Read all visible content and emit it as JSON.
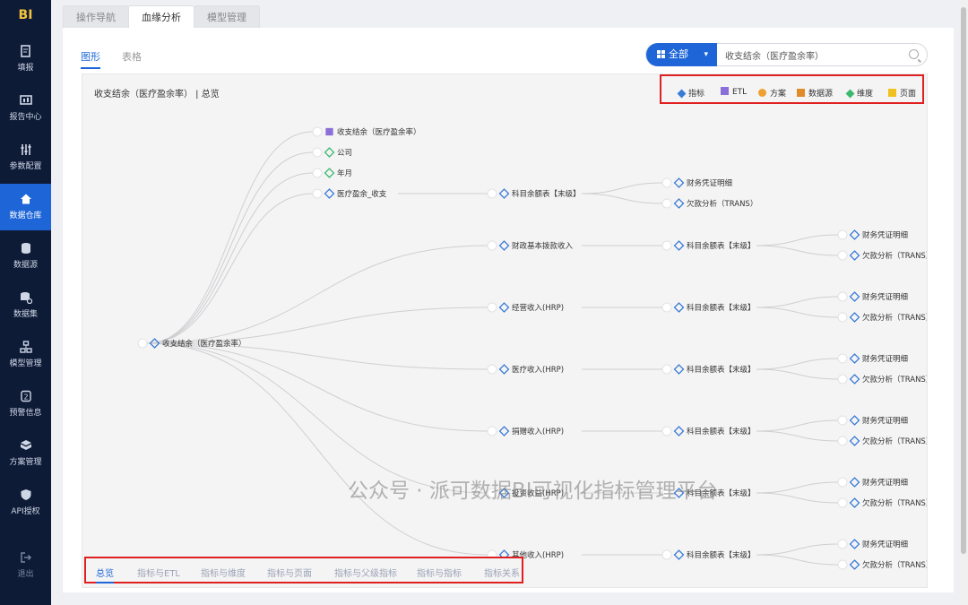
{
  "app": {
    "logo": "BI"
  },
  "sidebar": {
    "items": [
      {
        "label": "填报",
        "icon": "edit-icon"
      },
      {
        "label": "报告中心",
        "icon": "report-icon"
      },
      {
        "label": "参数配置",
        "icon": "sliders-icon"
      },
      {
        "label": "数据仓库",
        "icon": "home-icon",
        "active": true
      },
      {
        "label": "数据源",
        "icon": "database-icon"
      },
      {
        "label": "数据集",
        "icon": "dataset-icon"
      },
      {
        "label": "模型管理",
        "icon": "model-icon"
      },
      {
        "label": "预警信息",
        "icon": "alert-icon"
      },
      {
        "label": "方案管理",
        "icon": "cube-icon"
      },
      {
        "label": "API授权",
        "icon": "shield-icon"
      }
    ],
    "logout": "退出"
  },
  "tabs": [
    "操作导航",
    "血缘分析",
    "模型管理"
  ],
  "active_tab": "血缘分析",
  "subtabs": [
    "图形",
    "表格"
  ],
  "search": {
    "type": "全部",
    "value": "收支结余（医疗盈余率）"
  },
  "breadcrumb": "收支结余（医疗盈余率） | 总览",
  "legend": [
    {
      "label": "指标",
      "color": "#3a7bd5"
    },
    {
      "label": "ETL",
      "color": "#8a6fd8"
    },
    {
      "label": "方案",
      "color": "#f0a030"
    },
    {
      "label": "数据源",
      "color": "#e08a2a"
    },
    {
      "label": "维度",
      "color": "#3db86f"
    },
    {
      "label": "页面",
      "color": "#f0c020"
    }
  ],
  "graph": {
    "root": "收支结余（医疗盈余率）",
    "upper": [
      {
        "label": "收支结余（医疗盈余率）",
        "kind": "ETL"
      },
      {
        "label": "公司",
        "kind": "维度"
      },
      {
        "label": "年月",
        "kind": "维度"
      },
      {
        "label": "医疗盈余_收支",
        "kind": "指标"
      }
    ],
    "lower": [
      "财政基本拨款收入",
      "经营收入(HRP)",
      "医疗收入(HRP)",
      "捐赠收入(HRP)",
      "投资收益(HRP)",
      "其他收入(HRP)"
    ],
    "level3": "科目余额表【末级】",
    "leaves": [
      "财务凭证明细",
      "欠款分析（TRANS）"
    ]
  },
  "bottom_tabs": [
    "总览",
    "指标与ETL",
    "指标与维度",
    "指标与页面",
    "指标与父级指标",
    "指标与指标",
    "指标关系"
  ],
  "watermark": "公众号 · 派可数据BI可视化指标管理平台"
}
